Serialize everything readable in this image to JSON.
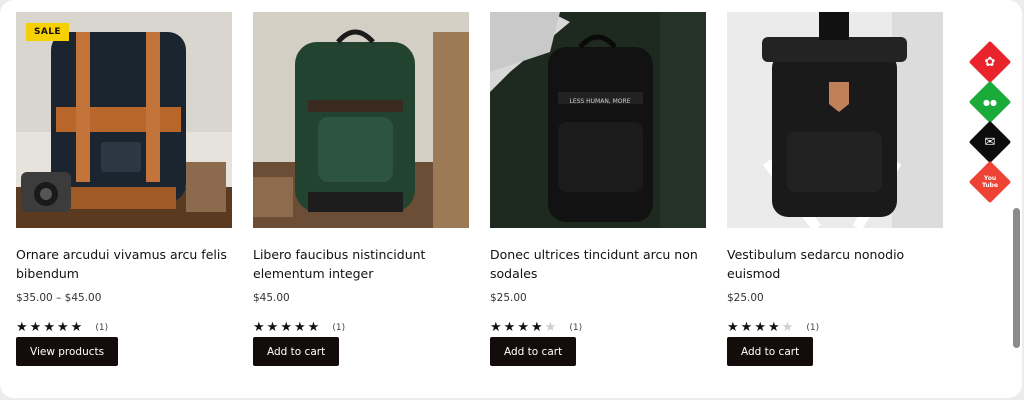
{
  "products": [
    {
      "image": "black-leather-backpack-photo",
      "badge": "SALE",
      "title": "Ornare arcudui vivamus arcu felis bibendum",
      "price": "$35.00 – $45.00",
      "rating": 5,
      "rating_count": "(1)",
      "button": "View products"
    },
    {
      "image": "green-canvas-backpack-photo",
      "title": "Libero faucibus nistincidunt elementum integer",
      "price": "$45.00",
      "rating": 5,
      "rating_count": "(1)",
      "button": "Add to cart"
    },
    {
      "image": "black-tech-backpack-photo",
      "title": "Donec ultrices tincidunt arcu non sodales",
      "price": "$25.00",
      "rating": 4,
      "rating_count": "(1)",
      "button": "Add to cart",
      "image_text": "LESS HUMAN, MORE"
    },
    {
      "image": "black-rolltop-backpack-photo",
      "title": "Vestibulum sedarcu nonodio euismod",
      "price": "$25.00",
      "rating": 4,
      "rating_count": "(1)",
      "button": "Add to cart"
    }
  ],
  "social": [
    {
      "name": "settings-icon",
      "color": "#e8232b",
      "glyph": "✿"
    },
    {
      "name": "wechat-icon",
      "color": "#1aab3a",
      "glyph": "●●"
    },
    {
      "name": "email-icon",
      "color": "#0d0d0d",
      "glyph": "✉"
    },
    {
      "name": "youtube-icon",
      "color": "#ee4235",
      "glyph": "You Tube"
    }
  ],
  "colors": {
    "badge": "#f6d000",
    "button": "#140c0a",
    "star": "#111111",
    "star_off": "#cfcfcf"
  }
}
